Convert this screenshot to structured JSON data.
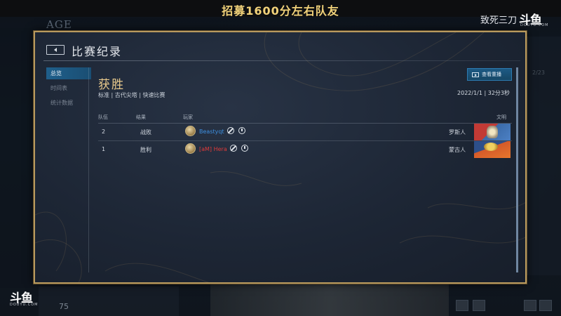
{
  "stream": {
    "banner": "招募1600分左右队友",
    "streamer": "致死三刀",
    "logo": "斗鱼",
    "logo_sub": "DOUYU.COM"
  },
  "background": {
    "age_text": "AGE",
    "bottom_number": "75",
    "right_number": "2/23"
  },
  "dialog": {
    "title": "比赛纪录",
    "sidebar": [
      {
        "label": "总览",
        "active": true
      },
      {
        "label": "时间表",
        "active": false
      },
      {
        "label": "统计数据",
        "active": false
      }
    ],
    "result": "获胜",
    "mode": "标准 | 古代尖塔 | 快速比赛",
    "replay_label": "查看重播",
    "date": "2022/1/1 | 32分3秒",
    "headers": {
      "team": "队伍",
      "result": "结果",
      "player": "玩家",
      "civ": "文明"
    },
    "rows": [
      {
        "team": "2",
        "result": "战败",
        "player": "Beastyqt",
        "player_color": "#3d8fe0",
        "civ": "罗斯人"
      },
      {
        "team": "1",
        "result": "胜利",
        "player": "[aM] Hera",
        "player_color": "#e03a3a",
        "civ": "蒙古人"
      }
    ]
  }
}
